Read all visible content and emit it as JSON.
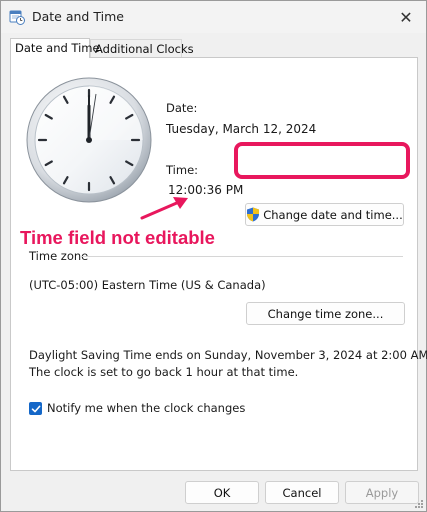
{
  "window": {
    "title": "Date and Time",
    "close_glyph": "✕"
  },
  "tabs": [
    {
      "label": "Date and Time",
      "active": true
    },
    {
      "label": "Additional Clocks",
      "active": false
    }
  ],
  "date": {
    "label": "Date:",
    "value": "Tuesday, March 12, 2024"
  },
  "time": {
    "label": "Time:",
    "value": "12:00:36 PM"
  },
  "buttons": {
    "change_date_time": "Change date and time...",
    "change_time_zone": "Change time zone...",
    "ok": "OK",
    "cancel": "Cancel",
    "apply": "Apply"
  },
  "annotation": {
    "text": "Time field not editable",
    "color": "#e8175d"
  },
  "time_zone": {
    "group_label": "Time zone",
    "value": "(UTC-05:00) Eastern Time (US & Canada)"
  },
  "dst": {
    "line1": "Daylight Saving Time ends on Sunday, November 3, 2024 at 2:00 AM.",
    "line2": "The clock is set to go back 1 hour at that time."
  },
  "notify": {
    "label": "Notify me when the clock changes",
    "checked": true
  },
  "icons": {
    "title": "date-time-app-icon",
    "shield": "uac-shield-icon",
    "checkmark": "checkmark-icon"
  },
  "colors": {
    "accent": "#1467c8",
    "highlight": "#e8175d"
  }
}
